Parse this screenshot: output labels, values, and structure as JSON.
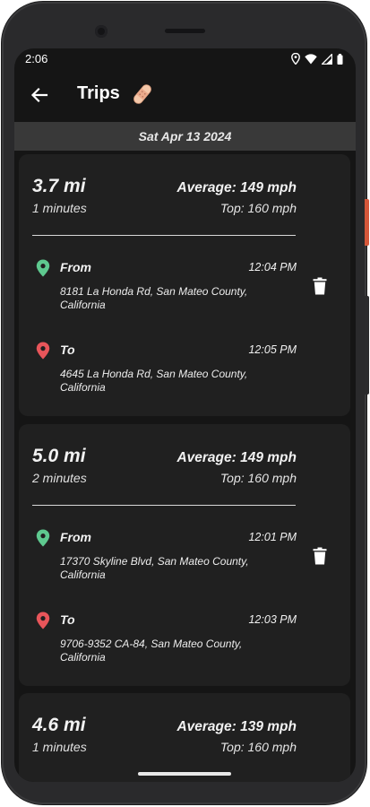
{
  "status": {
    "time": "2:06"
  },
  "appbar": {
    "title": "Trips",
    "title_emoji": "🩹"
  },
  "date_header": "Sat Apr 13 2024",
  "trips": [
    {
      "distance": "3.7 mi",
      "duration": "1 minutes",
      "average": "Average: 149 mph",
      "top": "Top: 160 mph",
      "from_label": "From",
      "from_time": "12:04 PM",
      "from_address": "8181 La Honda Rd, San Mateo County, California",
      "to_label": "To",
      "to_time": "12:05 PM",
      "to_address": "4645 La Honda Rd, San Mateo County, California"
    },
    {
      "distance": "5.0 mi",
      "duration": "2 minutes",
      "average": "Average: 149 mph",
      "top": "Top: 160 mph",
      "from_label": "From",
      "from_time": "12:01 PM",
      "from_address": "17370 Skyline Blvd, San Mateo County, California",
      "to_label": "To",
      "to_time": "12:03 PM",
      "to_address": "9706-9352 CA-84, San Mateo County, California"
    },
    {
      "distance": "4.6 mi",
      "duration": "1 minutes",
      "average": "Average: 139 mph",
      "top": "Top: 160 mph"
    }
  ],
  "colors": {
    "background": "#151515",
    "card": "#202020",
    "date_bar": "#393939",
    "from_pin": "#5ec98f",
    "to_pin": "#e8555a",
    "text": "#f2f2f2"
  },
  "icons": {
    "back": "arrow-left-icon",
    "from": "map-pin-icon",
    "to": "map-pin-icon",
    "delete": "trash-icon"
  }
}
